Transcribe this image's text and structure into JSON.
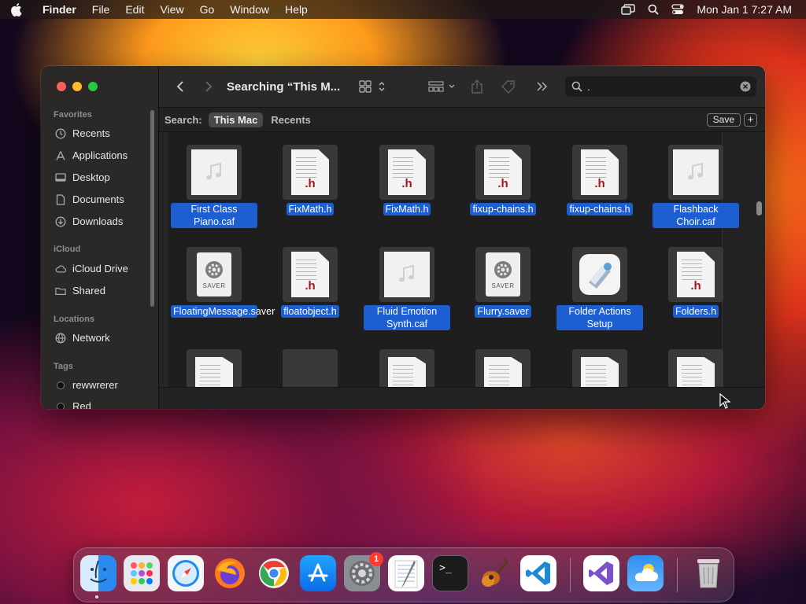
{
  "menubar": {
    "app_name": "Finder",
    "items": [
      "File",
      "Edit",
      "View",
      "Go",
      "Window",
      "Help"
    ],
    "clock": "Mon Jan 1  7:27 AM"
  },
  "window": {
    "title": "Searching “This M...",
    "search_query": ".",
    "scope": {
      "label": "Search:",
      "selected": "This Mac",
      "other": "Recents",
      "save_label": "Save",
      "add_label": "+"
    }
  },
  "sidebar": {
    "favorites_header": "Favorites",
    "favorites": [
      {
        "label": "Recents",
        "icon": "clock-icon"
      },
      {
        "label": "Applications",
        "icon": "applications-icon"
      },
      {
        "label": "Desktop",
        "icon": "desktop-icon"
      },
      {
        "label": "Documents",
        "icon": "document-icon"
      },
      {
        "label": "Downloads",
        "icon": "download-icon"
      }
    ],
    "icloud_header": "iCloud",
    "icloud": [
      {
        "label": "iCloud Drive",
        "icon": "cloud-icon"
      },
      {
        "label": "Shared",
        "icon": "shared-folder-icon"
      }
    ],
    "locations_header": "Locations",
    "locations": [
      {
        "label": "Network",
        "icon": "globe-icon"
      }
    ],
    "tags_header": "Tags",
    "tags": [
      {
        "label": "rewwrerer",
        "color": "#111111"
      },
      {
        "label": "Red",
        "color": "#111111"
      }
    ]
  },
  "files": [
    {
      "name": "First Class Piano.caf",
      "kind": "audio"
    },
    {
      "name": "FixMath.h",
      "kind": "header"
    },
    {
      "name": "FixMath.h",
      "kind": "header"
    },
    {
      "name": "fixup-chains.h",
      "kind": "header"
    },
    {
      "name": "fixup-chains.h",
      "kind": "header"
    },
    {
      "name": "Flashback Choir.caf",
      "kind": "audio"
    },
    {
      "name": "FloatingMessage.saver",
      "kind": "saver"
    },
    {
      "name": "floatobject.h",
      "kind": "header"
    },
    {
      "name": "Fluid Emotion Synth.caf",
      "kind": "audio"
    },
    {
      "name": "Flurry.saver",
      "kind": "saver"
    },
    {
      "name": "Folder Actions Setup",
      "kind": "app"
    },
    {
      "name": "Folders.h",
      "kind": "header"
    }
  ],
  "header_ext": ".h",
  "saver_label": "SAVER",
  "dock": {
    "apps": [
      "Finder",
      "Launchpad",
      "Safari",
      "Firefox",
      "Chrome",
      "App Store",
      "System Settings",
      "TextEdit",
      "Terminal",
      "GarageBand",
      "Visual Studio Code",
      "Visual Studio",
      "Weather",
      "Trash"
    ],
    "settings_badge": "1",
    "terminal_prompt": ">_"
  },
  "colors": {
    "selection": "#1d5fd1",
    "traffic_red": "#ff5f57",
    "traffic_yellow": "#febc2e",
    "traffic_green": "#28c840"
  }
}
